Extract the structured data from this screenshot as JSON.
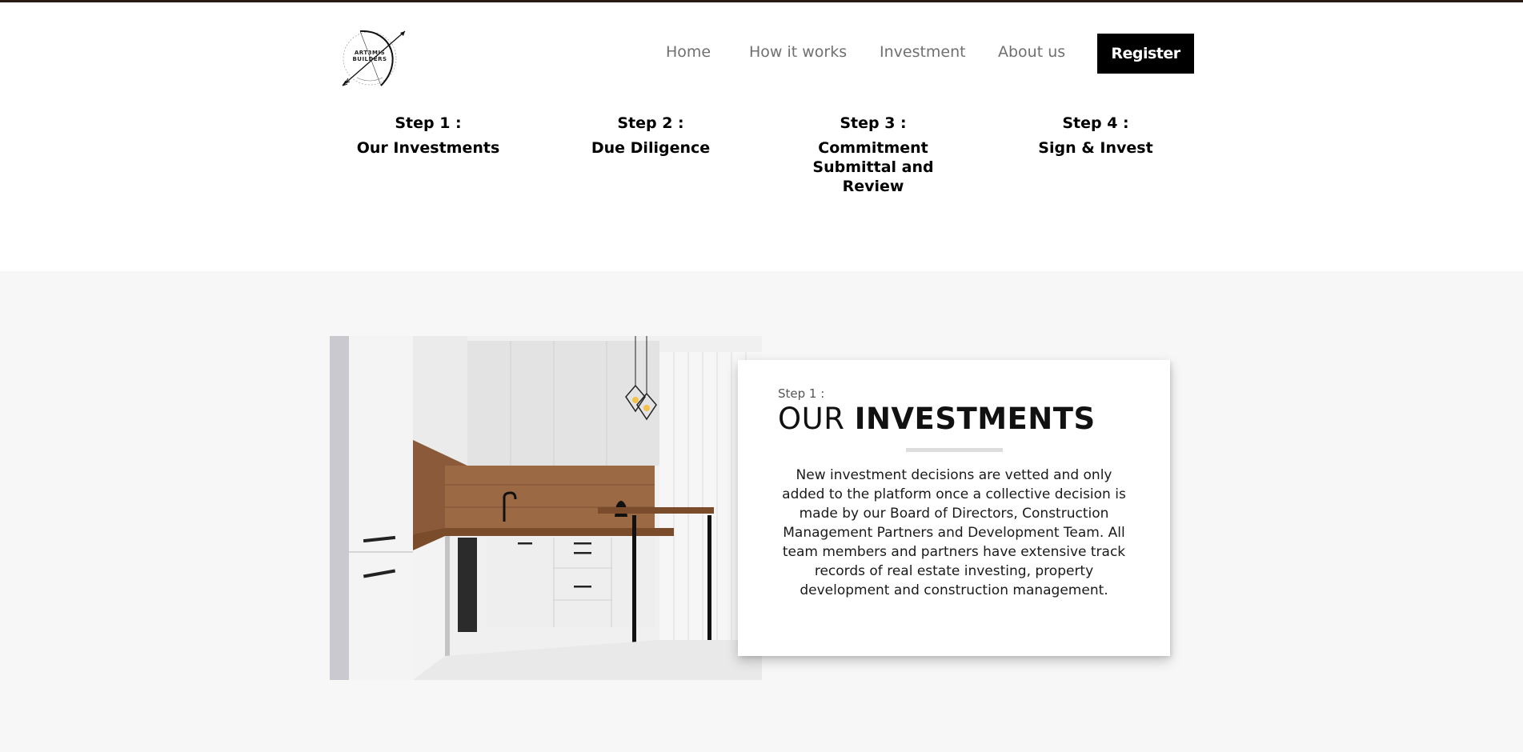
{
  "brand": {
    "logo_line1": "ART3MIS",
    "logo_line2": "BUILDERS"
  },
  "nav": {
    "items": [
      "Home",
      "How it works",
      "Investment",
      "About us"
    ],
    "register_label": "Register"
  },
  "steps": [
    {
      "number": "Step 1 :",
      "title": "Our Investments"
    },
    {
      "number": "Step 2 :",
      "title": "Due Diligence"
    },
    {
      "number": "Step 3 :",
      "title": "Commitment Submittal and Review"
    },
    {
      "number": "Step 4 :",
      "title": "Sign & Invest"
    }
  ],
  "feature": {
    "image": "kitchen-photo",
    "kicker": "Step 1 :",
    "heading_light": "OUR ",
    "heading_bold": "INVESTMENTS",
    "body": "New investment decisions are vetted and only added to the platform once a collective decision is made by our Board of Directors, Construction Management Partners and Development Team. All team members and partners have extensive track records of real estate investing, property development and construction management."
  },
  "colors": {
    "top_rule": "#2a1a14",
    "nav_text": "#707070",
    "register_bg": "#000000",
    "section_bg": "#f7f7f7"
  }
}
